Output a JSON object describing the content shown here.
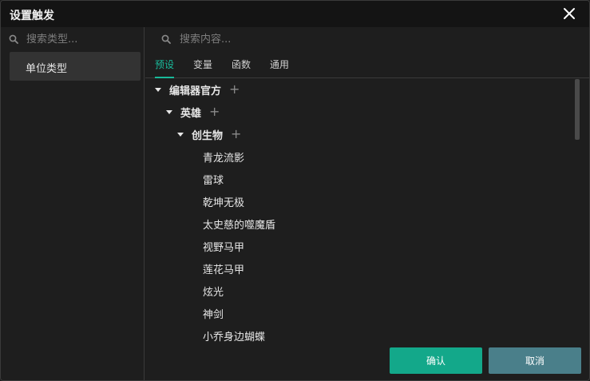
{
  "dialog": {
    "title": "设置触发"
  },
  "left_panel": {
    "search_placeholder": "搜索类型...",
    "categories": [
      {
        "label": "单位类型"
      }
    ]
  },
  "right_panel": {
    "search_placeholder": "搜索内容...",
    "tabs": [
      {
        "label": "预设",
        "active": true
      },
      {
        "label": "变量"
      },
      {
        "label": "函数"
      },
      {
        "label": "通用"
      }
    ],
    "tree": {
      "group1": {
        "label": "编辑器官方"
      },
      "group2": {
        "label": "英雄"
      },
      "group3": {
        "label": "创生物"
      },
      "items": [
        "青龙流影",
        "雷球",
        "乾坤无极",
        "太史慈的噬魔盾",
        "视野马甲",
        "莲花马甲",
        "炫光",
        "神剑",
        "小乔身边蝴蝶"
      ]
    }
  },
  "buttons": {
    "confirm": "确认",
    "cancel": "取消"
  },
  "colors": {
    "accent": "#19b99a",
    "confirm_bg": "#13a88a",
    "cancel_bg": "#4a7f8a"
  },
  "icons": {
    "search": "search-icon",
    "close": "close-icon",
    "expand": "caret-down-icon",
    "add": "plus-icon"
  }
}
